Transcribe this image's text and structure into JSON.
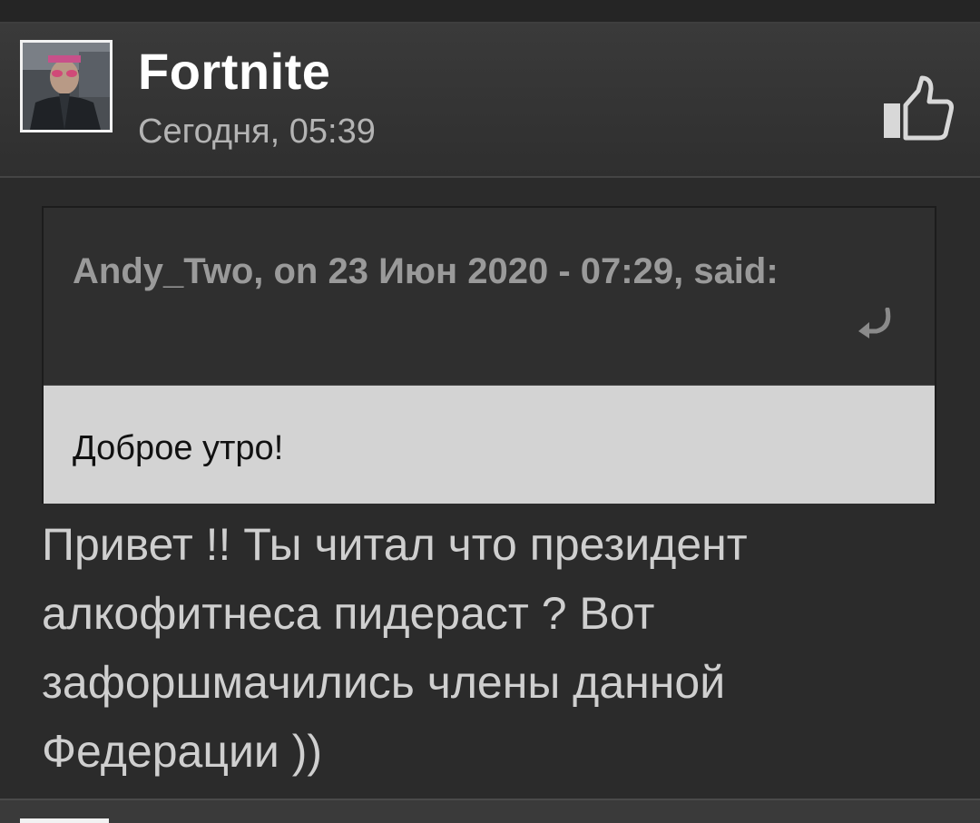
{
  "post": {
    "author": "Fortnite",
    "date": "Сегодня, 05:39",
    "avatar_icon": "user-photo-avatar",
    "like_icon": "thumbs-up-icon",
    "quote": {
      "citation": "Andy_Two, on 23 Июн 2020 - 07:29, said:",
      "jump_icon": "quote-jump-arrow-icon",
      "text": "Доброе утро!"
    },
    "body": "Привет !! Ты читал что президент алкофитнеса пидераст ? Вот зафоршмачились члены данной Федерации ))"
  },
  "colors": {
    "background": "#2b2b2b",
    "header": "#353535",
    "author": "#ffffff",
    "date": "#b4b4b4",
    "quote_body": "#d3d3d3",
    "body_text": "#cfcfcf"
  }
}
